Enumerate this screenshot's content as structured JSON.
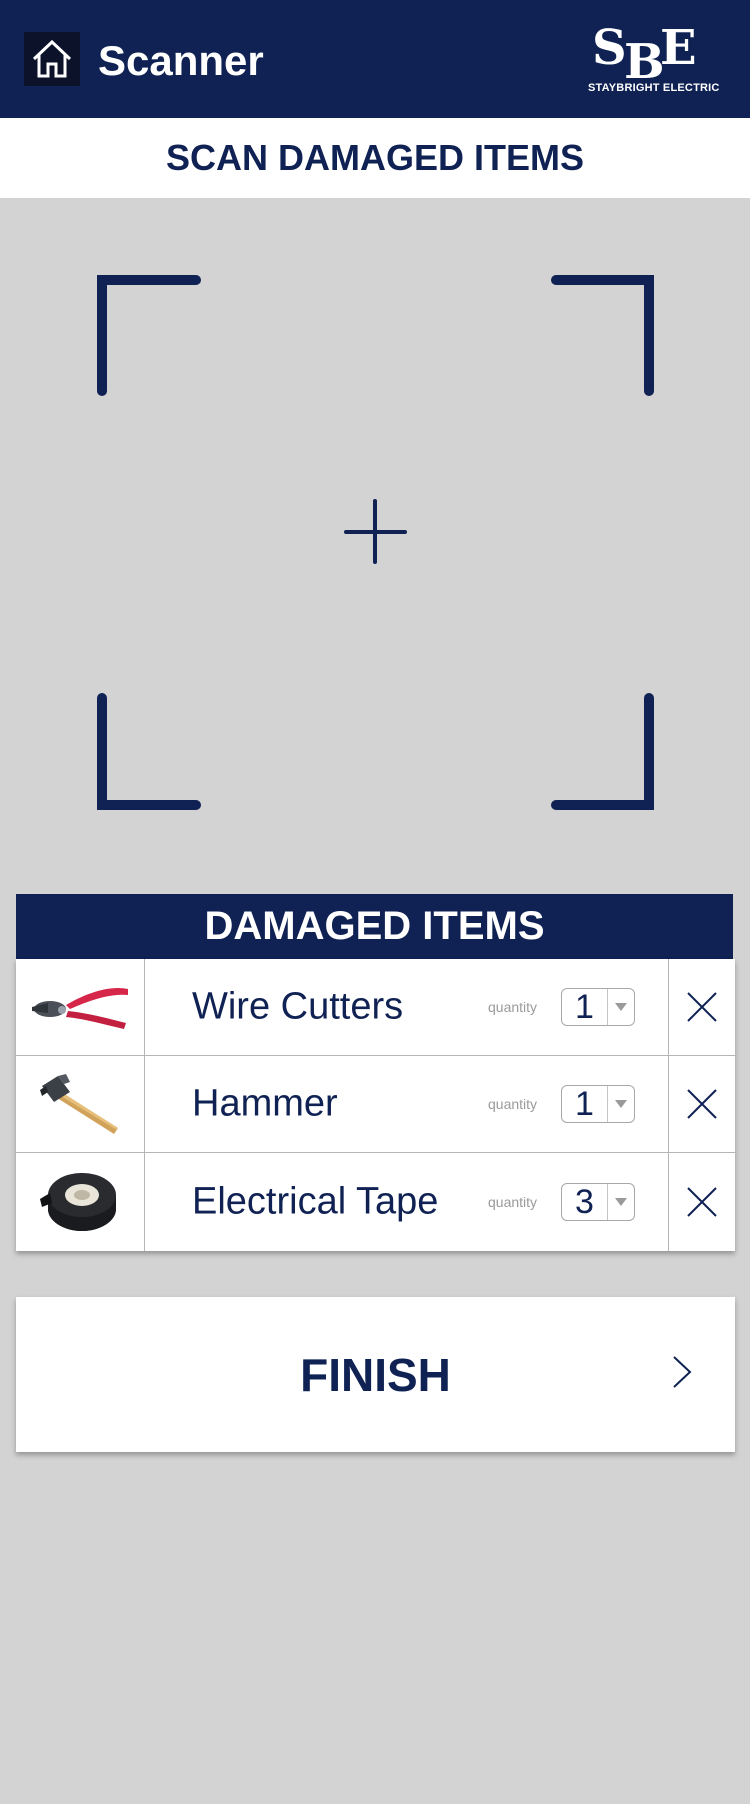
{
  "header": {
    "title": "Scanner",
    "home_icon": "home-icon",
    "logo": {
      "letters": "SBE",
      "subtitle": "STAYBRIGHT ELECTRIC"
    }
  },
  "page": {
    "title": "SCAN DAMAGED ITEMS"
  },
  "scanner": {
    "reticle_icon": "crosshair-icon",
    "frame": "corner-brackets"
  },
  "damaged_items": {
    "title": "DAMAGED ITEMS",
    "quantity_label": "quantity",
    "items": [
      {
        "name": "Wire Cutters",
        "quantity": "1",
        "image": "wire-cutters-icon"
      },
      {
        "name": "Hammer",
        "quantity": "1",
        "image": "hammer-icon"
      },
      {
        "name": "Electrical Tape",
        "quantity": "3",
        "image": "electrical-tape-icon"
      }
    ]
  },
  "finish": {
    "label": "FINISH",
    "icon": "chevron-right-icon"
  },
  "colors": {
    "brand_navy": "#0f2253",
    "background": "#d3d3d3",
    "surface": "#ffffff"
  }
}
